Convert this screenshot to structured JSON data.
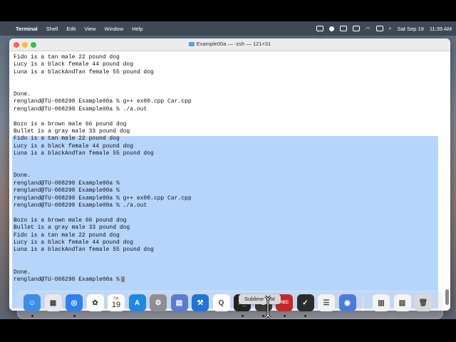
{
  "menubar": {
    "apple_glyph": "",
    "app_name": "Terminal",
    "items": [
      "Shell",
      "Edit",
      "View",
      "Window",
      "Help"
    ],
    "date": "Sat Sep 19",
    "time": "11:39 AM"
  },
  "window": {
    "title": "Example00a — -zsh — 121×31"
  },
  "terminal": {
    "lines": [
      "Fido is a tan male 22 pound dog",
      "Lucy is a black female 44 pound dog",
      "Luna is a blackAndTan female 55 pound dog",
      "",
      "",
      "Done.",
      "rengland@TU-008298 Example00a % g++ ex00.cpp Car.cpp",
      "rengland@TU-008298 Example00a % ./a.out",
      "",
      "Bozo is a brown male 66 pound dog",
      "Bullet is a gray male 33 pound dog",
      "Fido is a tan male 22 pound dog",
      "Lucy is a black female 44 pound dog",
      "Luna is a blackAndTan female 55 pound dog",
      "",
      "",
      "Done.",
      "rengland@TU-008298 Example00a %",
      "rengland@TU-008298 Example00a %",
      "rengland@TU-008298 Example00a % g++ ex00.cpp Car.cpp",
      "rengland@TU-008298 Example00a % ./a.out",
      "",
      "Bozo is a brown male 66 pound dog",
      "Bullet is a gray male 33 pound dog",
      "Fido is a tan male 22 pound dog",
      "Lucy is a black female 44 pound dog",
      "Luna is a blackAndTan female 55 pound dog",
      "",
      "",
      "Done.",
      "rengland@TU-008298 Example00a %"
    ],
    "selection_color": "#b5d5fb"
  },
  "tooltip": {
    "label": "Sublime Text"
  },
  "calendar": {
    "month": "Sat",
    "day": "19"
  },
  "dock": {
    "items": [
      {
        "name": "finder-icon",
        "color": "#3a8ee6",
        "glyph": "☺"
      },
      {
        "name": "launchpad-icon",
        "color": "#e8e8ee",
        "glyph": "▦"
      },
      {
        "name": "safari-icon",
        "color": "#2f80ed",
        "glyph": "◎"
      },
      {
        "name": "photos-icon",
        "color": "#ffffff",
        "glyph": "✿"
      },
      {
        "name": "calendar-icon",
        "color": "#ffffff",
        "glyph": ""
      },
      {
        "name": "app-store-icon",
        "color": "#1e88e5",
        "glyph": "A"
      },
      {
        "name": "system-preferences-icon",
        "color": "#8e8e93",
        "glyph": "⚙"
      },
      {
        "name": "preview-icon",
        "color": "#5b7bd5",
        "glyph": "▤"
      },
      {
        "name": "xcode-icon",
        "color": "#1f74d8",
        "glyph": "⚒"
      },
      {
        "name": "quicktime-icon",
        "color": "#ffffff",
        "glyph": "Q"
      },
      {
        "name": "terminal-icon",
        "color": "#222222",
        "glyph": ">_"
      },
      {
        "name": "sublime-text-icon",
        "color": "#3b3b3b",
        "glyph": "S"
      },
      {
        "name": "recorder-icon",
        "color": "#c62828",
        "glyph": "REC"
      },
      {
        "name": "omnifocus-icon",
        "color": "#2b2b2b",
        "glyph": "✓"
      },
      {
        "name": "notes-list-icon",
        "color": "#f2f2f2",
        "glyph": "☰"
      },
      {
        "name": "robot-app-icon",
        "color": "#4a7bd8",
        "glyph": "◉"
      },
      {
        "name": "document-thumbnail-icon",
        "color": "#f4f4f4",
        "glyph": "▥"
      },
      {
        "name": "screenshot-thumbnail-icon",
        "color": "#f4f4f4",
        "glyph": "▧"
      },
      {
        "name": "trash-icon",
        "color": "#d8d8d8",
        "glyph": "🗑"
      }
    ]
  }
}
